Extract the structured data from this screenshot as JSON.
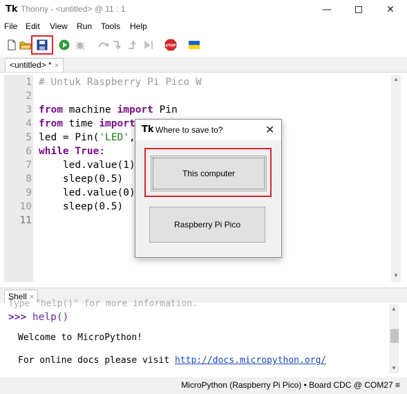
{
  "window": {
    "app_icon": "Tk",
    "title": "Thonny  -  <untitled>  @  11 : 1",
    "minimize": "—",
    "close": "✕"
  },
  "menu": [
    "File",
    "Edit",
    "View",
    "Run",
    "Tools",
    "Help"
  ],
  "toolbar": {
    "icons": [
      "new-file-icon",
      "open-folder-icon",
      "save-icon",
      "run-icon",
      "debug-icon",
      "step-over-icon",
      "step-into-icon",
      "step-out-icon",
      "resume-icon",
      "stop-icon",
      "ukraine-flag-icon"
    ],
    "stop_label": "STOP"
  },
  "editor": {
    "tab_label": "<untitled> *",
    "tab_close": "×",
    "line_numbers": [
      "1",
      "2",
      "3",
      "4",
      "5",
      "6",
      "7",
      "8",
      "9",
      "10",
      "11"
    ],
    "lines": {
      "l1_comment": "# Untuk Raspberry Pi Pico W",
      "l3_kw1": "from",
      "l3_mid": " machine ",
      "l3_kw2": "import",
      "l3_end": " Pin",
      "l4_kw1": "from",
      "l4_mid": " time ",
      "l4_kw2": "import",
      "l5_start": "led = Pin(",
      "l5_str": "'LED'",
      "l5_end": ",",
      "l6_kw1": "while",
      "l6_kw2": " True",
      "l6_end": ":",
      "l7_start": "    led.value(",
      "l7_num": "1",
      "l7_end": ")",
      "l8_start": "    sleep(",
      "l8_num": "0.5",
      "l8_end": ")",
      "l9_start": "    led.value(",
      "l9_num": "0",
      "l9_end": ")",
      "l10_start": "    sleep(",
      "l10_num": "0.5",
      "l10_end": ")"
    }
  },
  "shell": {
    "tab_label": "Shell",
    "tab_close": "×",
    "clipped_line": "Type \"help()\" for more information.",
    "prompt": ">>>",
    "command": " help()",
    "welcome": "Welcome to MicroPython!",
    "docs_text": "For online docs please visit ",
    "docs_link": "http://docs.micropython.org/"
  },
  "status": {
    "text": "MicroPython (Raspberry Pi Pico)  •  Board CDC @ COM27  ≡"
  },
  "dialog": {
    "icon": "Tk",
    "title": "Where to save to?",
    "close": "✕",
    "option1": "This computer",
    "option2": "Raspberry Pi Pico"
  },
  "colors": {
    "highlight": "#d9252f",
    "keyword": "#7a0d8a",
    "string": "#1f7c1f",
    "number": "#2255bb",
    "link": "#1a46c4"
  }
}
